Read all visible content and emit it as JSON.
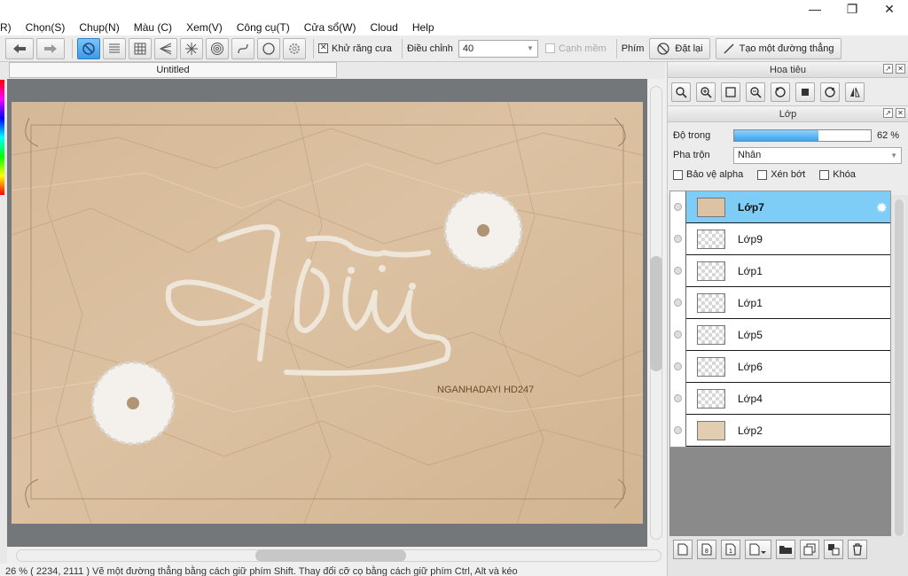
{
  "menu": {
    "items": [
      "R)",
      "Chọn(S)",
      "Chụp(N)",
      "Màu (C)",
      "Xem(V)",
      "Công cụ(T)",
      "Cửa sổ(W)",
      "Cloud",
      "Help"
    ]
  },
  "window_controls": {
    "minimize": "—",
    "restore": "❐",
    "close": "✕"
  },
  "toolbar": {
    "antialias_label": "Khử răng cưa",
    "adjust_label": "Điều chỉnh",
    "adjust_value": "40",
    "soft_edge_label": "Cạnh mềm",
    "key_label": "Phím",
    "reset_label": "Đặt lại",
    "create_line_label": "Tạo một đường thẳng"
  },
  "document": {
    "tab_title": "Untitled"
  },
  "artwork": {
    "signature": "NGANHADAYI HD247"
  },
  "status": {
    "text": "26 %   ( 2234, 2111 )   Vẽ một đường thẳng bằng cách giữ phím Shift. Thay đổi cỡ cọ bằng cách giữ phím Ctrl, Alt và kéo"
  },
  "navigator": {
    "title": "Hoa tiêu"
  },
  "layers_panel": {
    "title": "Lớp",
    "opacity_label": "Độ trong",
    "opacity_percent": 62,
    "opacity_text": "62 %",
    "blend_label": "Pha trộn",
    "blend_value": "Nhân",
    "protect_alpha_label": "Bảo vệ alpha",
    "clipping_label": "Xén bớt",
    "lock_label": "Khóa",
    "layers": [
      {
        "name": "Lớp7",
        "thumb": "paper",
        "selected": true
      },
      {
        "name": "Lớp9",
        "thumb": "transparent",
        "selected": false
      },
      {
        "name": "Lớp1",
        "thumb": "transparent",
        "selected": false
      },
      {
        "name": "Lớp1",
        "thumb": "transparent",
        "selected": false
      },
      {
        "name": "Lớp5",
        "thumb": "transparent",
        "selected": false
      },
      {
        "name": "Lớp6",
        "thumb": "transparent",
        "selected": false
      },
      {
        "name": "Lớp4",
        "thumb": "transparent",
        "selected": false
      },
      {
        "name": "Lớp2",
        "thumb": "paper2",
        "selected": false
      }
    ]
  },
  "colors": {
    "accent": "#3a9be8",
    "selected_layer": "#7dcdf6",
    "paper": "#d9bf9d",
    "canvas_bg": "#74777a"
  }
}
